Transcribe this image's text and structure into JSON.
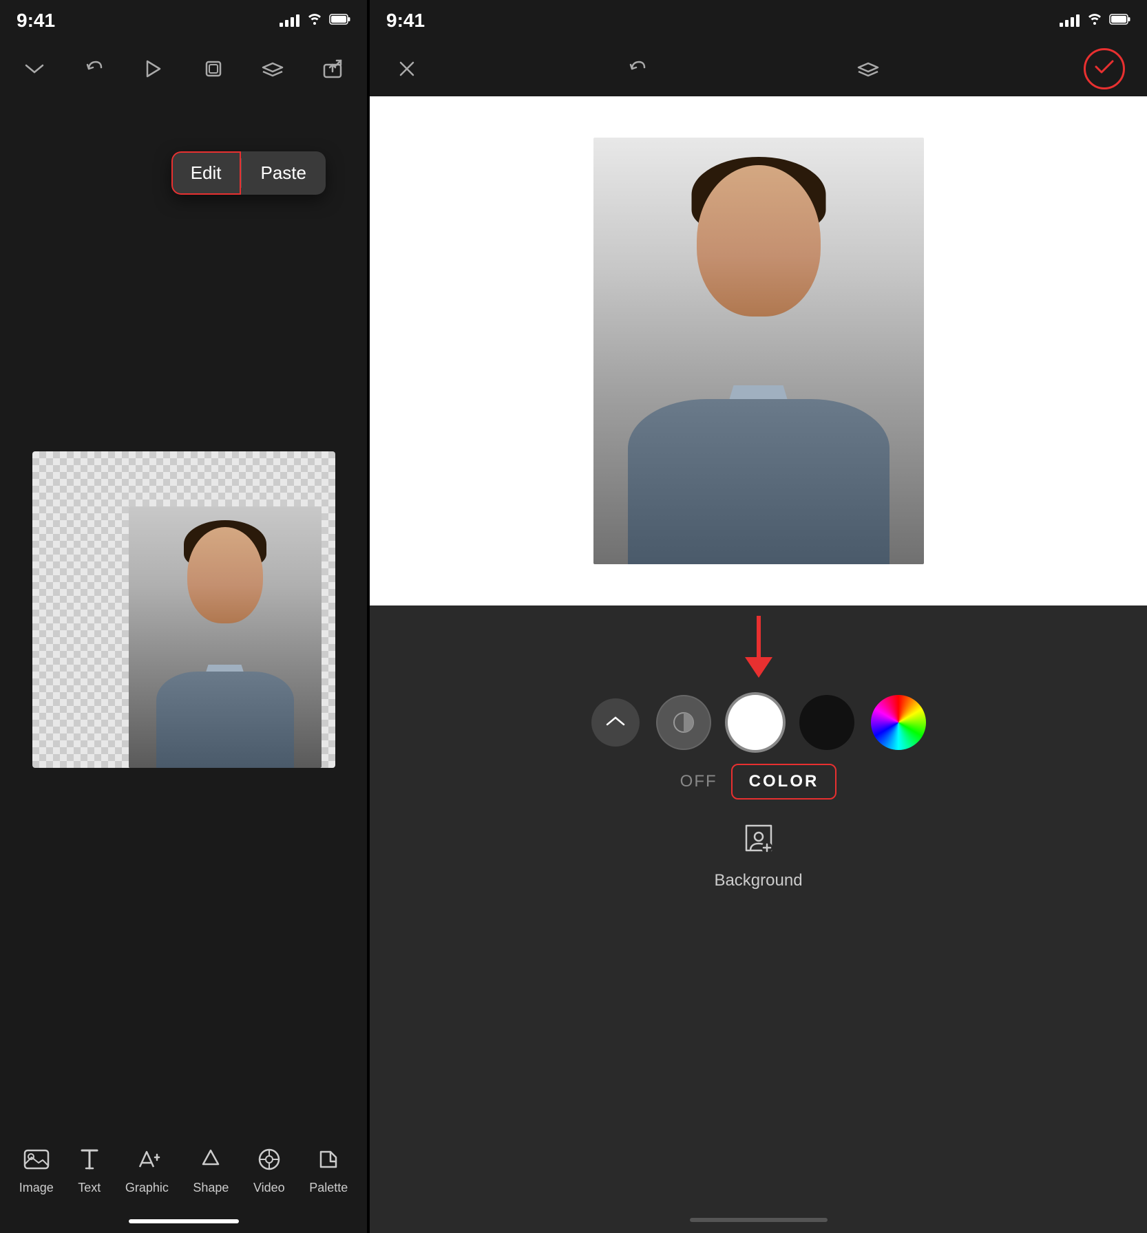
{
  "left": {
    "statusBar": {
      "time": "9:41"
    },
    "toolbar": {
      "icons": [
        "chevron-down",
        "undo",
        "play",
        "layers-single",
        "layers",
        "share"
      ]
    },
    "contextMenu": {
      "edit": "Edit",
      "paste": "Paste"
    },
    "bottomTools": [
      {
        "id": "image",
        "label": "Image"
      },
      {
        "id": "text",
        "label": "Text"
      },
      {
        "id": "graphic",
        "label": "Graphic"
      },
      {
        "id": "shape",
        "label": "Shape"
      },
      {
        "id": "video",
        "label": "Video"
      },
      {
        "id": "palette",
        "label": "Palette"
      }
    ]
  },
  "right": {
    "statusBar": {
      "time": "9:41"
    },
    "toolbar": {
      "closeIcon": "✕",
      "undoIcon": "↩",
      "layersIcon": "layers",
      "checkIcon": "✓"
    },
    "colorPanel": {
      "offLabel": "OFF",
      "colorLabel": "COLOR",
      "backgroundLabel": "Background"
    }
  },
  "colors": {
    "accent": "#e83030",
    "white": "#ffffff",
    "black": "#111111"
  }
}
